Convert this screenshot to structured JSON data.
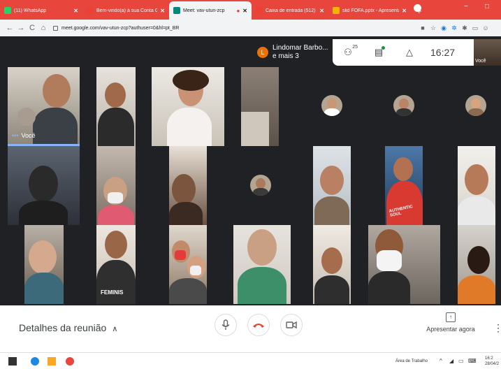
{
  "browser": {
    "tabs": [
      {
        "label": "(11) WhatsApp",
        "favicon_color": "#25d366",
        "active": false
      },
      {
        "label": "Bem-vindo(a) à sua Conta G",
        "favicon_color": "#ea4335",
        "active": false
      },
      {
        "label": "Meet: vav-utun-zcp",
        "favicon_color": "#00897b",
        "active": true
      },
      {
        "label": "Caixa de entrada (512) - alv",
        "favicon_color": "#ea4335",
        "active": false
      },
      {
        "label": "slid FOFA.pptx - Apresentaçã",
        "favicon_color": "#f4b400",
        "active": false
      }
    ],
    "new_tab": "+",
    "window_controls": [
      "−",
      "□"
    ],
    "url": "meet.google.com/vav-utun-zcp?authuser=0&hl=pt_BR",
    "nav": {
      "back": "←",
      "forward": "→",
      "reload": "C",
      "home": "⌂"
    }
  },
  "meet": {
    "host": {
      "initial": "L",
      "name": "Lindomar Barbo...",
      "more": "e mais 3"
    },
    "participants_count": "25",
    "clock": "16:27",
    "self_label": "Você",
    "tiles": [
      {
        "label": "Você",
        "speaking": true
      }
    ],
    "shirt_texts": [
      "FEMINIS",
      "AUTHENTIC SOUL"
    ],
    "meeting_details": "Detalhes da reunião",
    "present": "Apresentar agora",
    "colors": {
      "leave_red": "#ea4335",
      "accent_blue": "#8ab4f8",
      "bar_bg": "#ffffff"
    }
  },
  "taskbar": {
    "desktop_label": "Área de Trabalho",
    "time": "16:2",
    "date": "28/04/2"
  }
}
